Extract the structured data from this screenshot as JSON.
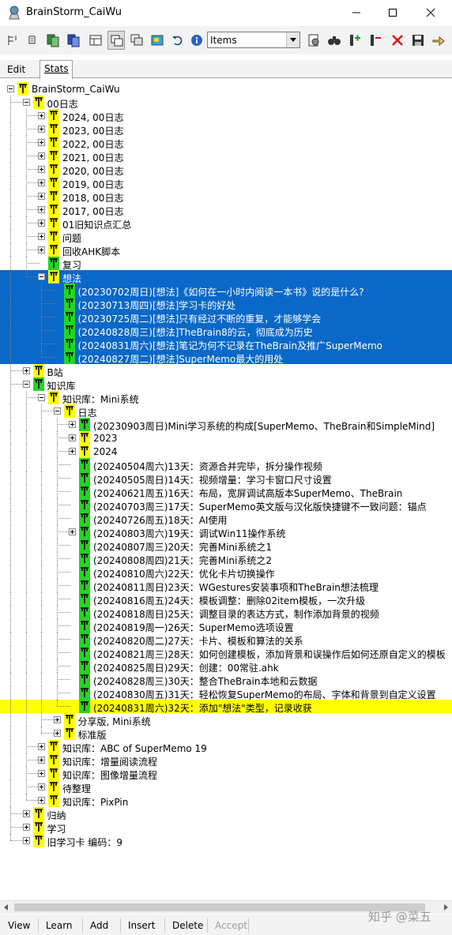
{
  "window": {
    "title": "BrainStorm_CaiWu"
  },
  "toolbar": {
    "view_select_value": "Items"
  },
  "tabs": [
    {
      "label": "Edit",
      "active": false
    },
    {
      "label": "Stats",
      "active": true
    }
  ],
  "tree": {
    "rows": [
      {
        "depth": 0,
        "exp": "minus",
        "icon": "yellow",
        "label": "BrainStorm_CaiWu"
      },
      {
        "depth": 1,
        "exp": "minus",
        "icon": "yellow",
        "label": "00日志"
      },
      {
        "depth": 2,
        "exp": "plus",
        "icon": "yellow",
        "label": "2024, 00日志"
      },
      {
        "depth": 2,
        "exp": "plus",
        "icon": "yellow",
        "label": "2023, 00日志"
      },
      {
        "depth": 2,
        "exp": "plus",
        "icon": "yellow",
        "label": "2022, 00日志"
      },
      {
        "depth": 2,
        "exp": "plus",
        "icon": "yellow",
        "label": "2021, 00日志"
      },
      {
        "depth": 2,
        "exp": "plus",
        "icon": "yellow",
        "label": "2020, 00日志"
      },
      {
        "depth": 2,
        "exp": "plus",
        "icon": "yellow",
        "label": "2019, 00日志"
      },
      {
        "depth": 2,
        "exp": "plus",
        "icon": "yellow",
        "label": "2018, 00日志"
      },
      {
        "depth": 2,
        "exp": "plus",
        "icon": "yellow",
        "label": "2017, 00日志"
      },
      {
        "depth": 2,
        "exp": "plus",
        "icon": "yellow",
        "label": "01旧知识点汇总"
      },
      {
        "depth": 2,
        "exp": "plus",
        "icon": "yellow",
        "label": "问题"
      },
      {
        "depth": 2,
        "exp": "plus",
        "icon": "yellow",
        "label": "回收AHK脚本"
      },
      {
        "depth": 2,
        "exp": "none",
        "icon": "green",
        "label": "复习"
      },
      {
        "depth": 2,
        "exp": "minus",
        "icon": "yellow",
        "label": "想法",
        "state": "sel"
      },
      {
        "depth": 3,
        "exp": "none",
        "icon": "green",
        "label": "(20230702周日)[想法]《如何在一小时内阅读一本书》说的是什么?",
        "state": "sel"
      },
      {
        "depth": 3,
        "exp": "none",
        "icon": "green",
        "label": "(20230713周四)[想法]学习卡的好处",
        "state": "sel"
      },
      {
        "depth": 3,
        "exp": "none",
        "icon": "green",
        "label": "(20230725周二)[想法]只有经过不断的重复，才能够学会",
        "state": "sel"
      },
      {
        "depth": 3,
        "exp": "none",
        "icon": "green",
        "label": "(20240828周三)[想法]TheBrain8的云，彻底成为历史",
        "state": "sel"
      },
      {
        "depth": 3,
        "exp": "none",
        "icon": "green",
        "label": "(20240831周六)[想法]笔记为何不记录在TheBrain及推广SuperMemo",
        "state": "sel"
      },
      {
        "depth": 3,
        "exp": "none",
        "icon": "green",
        "label": "(20240827周二)[想法]SuperMemo最大的用处",
        "state": "sel"
      },
      {
        "depth": 1,
        "exp": "plus",
        "icon": "yellow",
        "label": "B站"
      },
      {
        "depth": 1,
        "exp": "minus",
        "icon": "green",
        "label": "知识库"
      },
      {
        "depth": 2,
        "exp": "minus",
        "icon": "yellow",
        "label": "知识库：Mini系统"
      },
      {
        "depth": 3,
        "exp": "minus",
        "icon": "yellow",
        "label": "日志"
      },
      {
        "depth": 4,
        "exp": "plus",
        "icon": "green",
        "label": "(20230903周日)Mini学习系统的构成[SuperMemo、TheBrain和SimpleMind]"
      },
      {
        "depth": 4,
        "exp": "plus",
        "icon": "yellow",
        "label": "2023"
      },
      {
        "depth": 4,
        "exp": "plus",
        "icon": "yellow",
        "label": "2024"
      },
      {
        "depth": 4,
        "exp": "none",
        "icon": "green",
        "label": "(20240504周六)13天：资源合并完毕，拆分操作视频"
      },
      {
        "depth": 4,
        "exp": "none",
        "icon": "green",
        "label": "(20240505周日)14天：视频增量：学习卡窗口尺寸设置"
      },
      {
        "depth": 4,
        "exp": "none",
        "icon": "green",
        "label": "(20240621周五)16天：布局，宽屏调试高版本SuperMemo、TheBrain"
      },
      {
        "depth": 4,
        "exp": "none",
        "icon": "green",
        "label": "(20240703周三)17天：SuperMemo英文版与汉化版快捷键不一致问题：锚点"
      },
      {
        "depth": 4,
        "exp": "none",
        "icon": "green",
        "label": "(20240726周五)18天：AI使用"
      },
      {
        "depth": 4,
        "exp": "plus",
        "icon": "green",
        "label": "(20240803周六)19天：调试Win11操作系统"
      },
      {
        "depth": 4,
        "exp": "none",
        "icon": "green",
        "label": "(20240807周三)20天：完善Mini系统之1"
      },
      {
        "depth": 4,
        "exp": "none",
        "icon": "green",
        "label": "(20240808周四)21天：完善Mini系统之2"
      },
      {
        "depth": 4,
        "exp": "none",
        "icon": "green",
        "label": "(20240810周六)22天：优化卡片切换操作"
      },
      {
        "depth": 4,
        "exp": "none",
        "icon": "green",
        "label": "(20240811周日)23天：WGestures安装事项和TheBrain想法梳理"
      },
      {
        "depth": 4,
        "exp": "none",
        "icon": "green",
        "label": "(20240816周五)24天：模板调整：删除02item模板，一次升级"
      },
      {
        "depth": 4,
        "exp": "none",
        "icon": "green",
        "label": "(20240818周日)25天：调整目录的表达方式，制作添加背景的视频"
      },
      {
        "depth": 4,
        "exp": "none",
        "icon": "green",
        "label": "(20240819周一)26天：SuperMemo选项设置"
      },
      {
        "depth": 4,
        "exp": "none",
        "icon": "green",
        "label": "(20240820周二)27天：卡片、模板和算法的关系"
      },
      {
        "depth": 4,
        "exp": "none",
        "icon": "green",
        "label": "(20240821周三)28天：如何创建模板，添加背景和误操作后如何还原自定义的模板"
      },
      {
        "depth": 4,
        "exp": "none",
        "icon": "green",
        "label": "(20240825周日)29天：创建：00常驻.ahk"
      },
      {
        "depth": 4,
        "exp": "none",
        "icon": "green",
        "label": "(20240828周三)30天：整合TheBrain本地和云数据"
      },
      {
        "depth": 4,
        "exp": "none",
        "icon": "green",
        "label": "(20240830周五)31天：轻松恢复SuperMemo的布局、字体和背景到自定义设置"
      },
      {
        "depth": 4,
        "exp": "none",
        "icon": "green",
        "label": "(20240831周六)32天：添加\"想法\"类型，记录收获",
        "state": "hl"
      },
      {
        "depth": 3,
        "exp": "plus",
        "icon": "yellow",
        "label": "分享版, Mini系统"
      },
      {
        "depth": 3,
        "exp": "plus",
        "icon": "yellow",
        "label": "标准版"
      },
      {
        "depth": 2,
        "exp": "plus",
        "icon": "yellow",
        "label": "知识库：ABC of SuperMemo 19"
      },
      {
        "depth": 2,
        "exp": "plus",
        "icon": "yellow",
        "label": "知识库：增量阅读流程"
      },
      {
        "depth": 2,
        "exp": "plus",
        "icon": "yellow",
        "label": "知识库：图像增量流程"
      },
      {
        "depth": 2,
        "exp": "plus",
        "icon": "yellow",
        "label": "待整理"
      },
      {
        "depth": 2,
        "exp": "plus",
        "icon": "yellow",
        "label": "知识库：PixPin"
      },
      {
        "depth": 1,
        "exp": "plus",
        "icon": "yellow",
        "label": "归纳"
      },
      {
        "depth": 1,
        "exp": "plus",
        "icon": "yellow",
        "label": "学习"
      },
      {
        "depth": 1,
        "exp": "plus",
        "icon": "yellow",
        "label": "旧学习卡 编码：9"
      }
    ]
  },
  "bottom_buttons": [
    {
      "label": "View",
      "enabled": true
    },
    {
      "label": "Learn",
      "enabled": true
    },
    {
      "label": "Add",
      "enabled": true
    },
    {
      "label": "Insert",
      "enabled": true
    },
    {
      "label": "Delete",
      "enabled": true
    },
    {
      "label": "Accept",
      "enabled": false
    }
  ],
  "watermark": "知乎 @菜五",
  "colors": {
    "selection_bg": "#0a68c8",
    "highlight_bg": "#ffff00",
    "icon_yellow": "#ffff00",
    "icon_green": "#22d622"
  }
}
